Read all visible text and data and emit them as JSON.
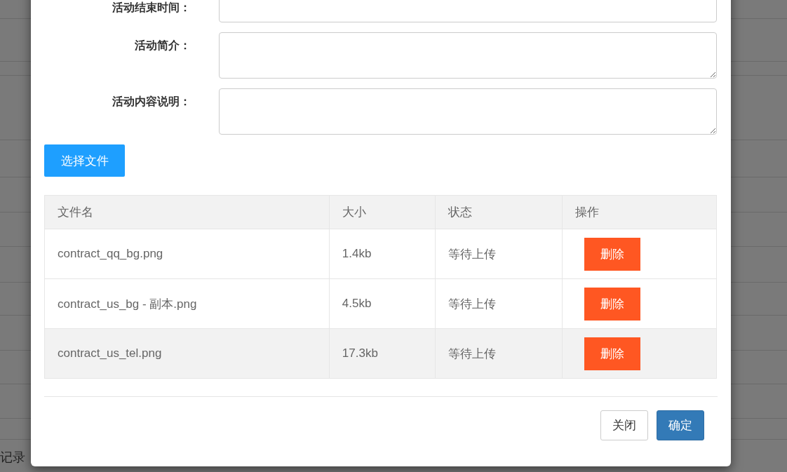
{
  "background_page": {
    "footer_text": "记录"
  },
  "dialog": {
    "fields": [
      {
        "label": "活动结束时间：",
        "kind": "input"
      },
      {
        "label": "活动简介：",
        "kind": "textarea"
      },
      {
        "label": "活动内容说明：",
        "kind": "textarea"
      }
    ],
    "choose_file_button": "选择文件",
    "file_table": {
      "columns": [
        "文件名",
        "大小",
        "状态",
        "操作"
      ],
      "rows": [
        {
          "name": "contract_qq_bg.png",
          "size": "1.4kb",
          "status": "等待上传",
          "action": "删除",
          "highlighted": false
        },
        {
          "name": "contract_us_bg - 副本.png",
          "size": "4.5kb",
          "status": "等待上传",
          "action": "删除",
          "highlighted": false
        },
        {
          "name": "contract_us_tel.png",
          "size": "17.3kb",
          "status": "等待上传",
          "action": "删除",
          "highlighted": true
        }
      ]
    },
    "buttons": [
      {
        "label": "关闭",
        "kind": "default"
      },
      {
        "label": "确定",
        "kind": "primary"
      }
    ]
  }
}
